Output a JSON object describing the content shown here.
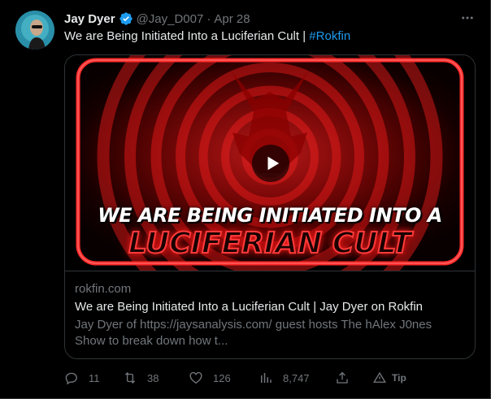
{
  "tweet": {
    "author": {
      "name": "Jay Dyer",
      "handle": "@Jay_D007",
      "separator": "·",
      "date": "Apr 28",
      "verified": true
    },
    "text": "We are Being Initiated Into a Luciferian Cult | ",
    "hashtag": "#Rokfin",
    "card": {
      "headline_line1": "WE ARE BEING INITIATED INTO A",
      "headline_line2": "LUCIFERIAN CULT",
      "domain": "rokfin.com",
      "title": "We are Being Initiated Into a Luciferian Cult | Jay Dyer on Rokfin",
      "description": "Jay Dyer of https://jaysanalysis.com/ guest hosts The hAlex J0nes Show to break down how t..."
    },
    "actions": {
      "replies": "11",
      "retweets": "38",
      "likes": "126",
      "views": "8,747",
      "tip_label": "Tip"
    },
    "icons": [
      "more-icon",
      "verified-badge-icon",
      "play-icon",
      "reply-icon",
      "retweet-icon",
      "like-icon",
      "views-icon",
      "share-icon",
      "tip-icon"
    ],
    "colors": {
      "background": "#000000",
      "primary_text": "#e7e9ea",
      "secondary_text": "#71767b",
      "accent": "#1d9bf0",
      "border": "#2f3336",
      "thumbnail_red": "#ff2a2a"
    }
  }
}
